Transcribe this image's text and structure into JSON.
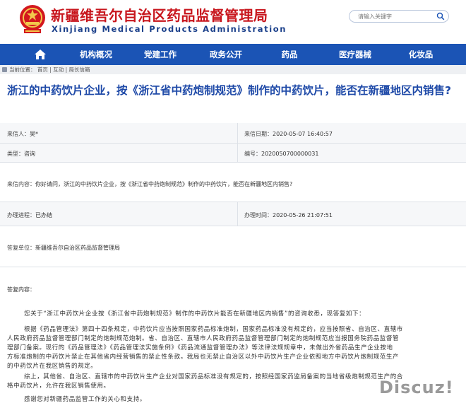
{
  "header": {
    "org_name_cn": "新疆维吾尔自治区药品监督管理局",
    "org_name_en": "Xinjiang Medical Products Administration",
    "search_placeholder": "请输入关键字"
  },
  "nav": {
    "items": [
      {
        "label": "机构概况"
      },
      {
        "label": "党建工作"
      },
      {
        "label": "政务公开"
      },
      {
        "label": "药品"
      },
      {
        "label": "医疗器械"
      },
      {
        "label": "化妆品"
      }
    ]
  },
  "breadcrumb": {
    "prefix": "当前位置：",
    "items": [
      "首页",
      "互动",
      "局长信箱"
    ],
    "separator": "|"
  },
  "letter": {
    "title": "浙江的中药饮片企业，按《浙江省中药炮制规范》制作的中药饮片，能否在新疆地区内销售?",
    "from_label": "来信人：",
    "from_value": "吴*",
    "date_label": "来信日期：",
    "date_value": "2020-05-07 16:40:57",
    "type_label": "类型：",
    "type_value": "咨询",
    "id_label": "编号：",
    "id_value": "2020050700000031",
    "content_label": "来信内容：",
    "content_value": "你好请问，浙江的中药饮片企业，按《浙江省中药炮制规范》制作的中药饮片，能否在新疆地区内销售?",
    "progress_label": "办理进程：",
    "progress_value": "已办结",
    "reply_date_label": "办理时间：",
    "reply_date_value": "2020-05-26 21:07:51",
    "reply_unit_label": "答复单位：",
    "reply_unit_value": "新疆维吾尔自治区药品监督管理局",
    "reply_content_label": "答复内容："
  },
  "reply": {
    "lines": [
      "您关于“浙江中药饮片企业按《浙江省中药炮制规范》制作的中药饮片能否在新疆地区内销售”的咨询收悉，现答复如下：",
      "根据《药品管理法》第四十四条规定，中药饮片应当按照国家药品标准炮制，国家药品标准没有规定的，应当按照省、自治区、直辖市",
      "人民政府药品监督管理部门制定的炮制规范炮制。省、自治区、直辖市人民政府药品监督管理部门制定的炮制规范应当报国务院药品监督管",
      "理部门备案。现行的《药品管理法》《药品管理法实施条例》《药品流通监督管理办法》等法律法规规章中，未做出外省药品生产企业按地",
      "方标准炮制的中药饮片禁止在其他省内经营销售的禁止性条款。我局也无禁止自治区以外中药饮片生产企业依照地方中药饮片炮制规范生产",
      "的中药饮片在我区销售的规定。",
      "综上，其他省、自治区、直辖市的中药饮片生产企业对国家药品标准没有规定的，按照经国家药监局备案的当地省级炮制规范生产的合",
      "格中药饮片，允许在我区销售使用。",
      "感谢您对新疆药品监管工作的关心和支持。"
    ]
  },
  "watermark": "Discuz!",
  "colors": {
    "nav_bg": "#1b54b5",
    "title": "#1f4aa8",
    "org_name": "#c8161d"
  },
  "icons": {
    "emblem": "national-emblem-icon",
    "home": "home-icon",
    "search": "search-icon"
  }
}
